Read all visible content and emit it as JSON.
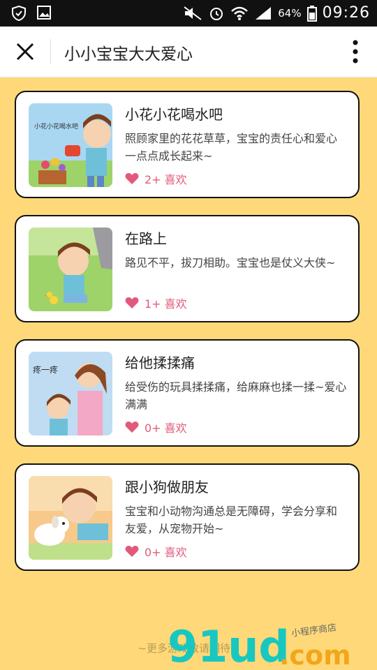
{
  "status_bar": {
    "battery": "64%",
    "time": "09:26"
  },
  "nav": {
    "title": "小小宝宝大大爱心"
  },
  "cards": [
    {
      "title": "小花小花喝水吧",
      "desc": "照顾家里的花花草草，宝宝的责任心和爱心一点点成长起来~",
      "likes": "2+ 喜欢",
      "thumb_caption": "小花小花喝水吧"
    },
    {
      "title": "在路上",
      "desc": "路见不平，拔刀相助。宝宝也是仗义大侠~",
      "likes": "1+ 喜欢"
    },
    {
      "title": "给他揉揉痛",
      "desc": "给受伤的玩具揉揉痛，给麻麻也揉一揉~爱心满满",
      "likes": "0+ 喜欢",
      "thumb_caption": "疼一疼"
    },
    {
      "title": "跟小狗做朋友",
      "desc": "宝宝和小动物沟通总是无障碍，学会分享和友爱，从宠物开始~",
      "likes": "0+ 喜欢"
    }
  ],
  "footer": {
    "text": "~更多游戏敬请期待~"
  },
  "watermark": {
    "brand": "91ud",
    "domain": ".com",
    "tagline": "小程序商店"
  },
  "colors": {
    "background": "#FFD979",
    "accent_pink": "#E25A7B",
    "card_border": "#111111"
  }
}
